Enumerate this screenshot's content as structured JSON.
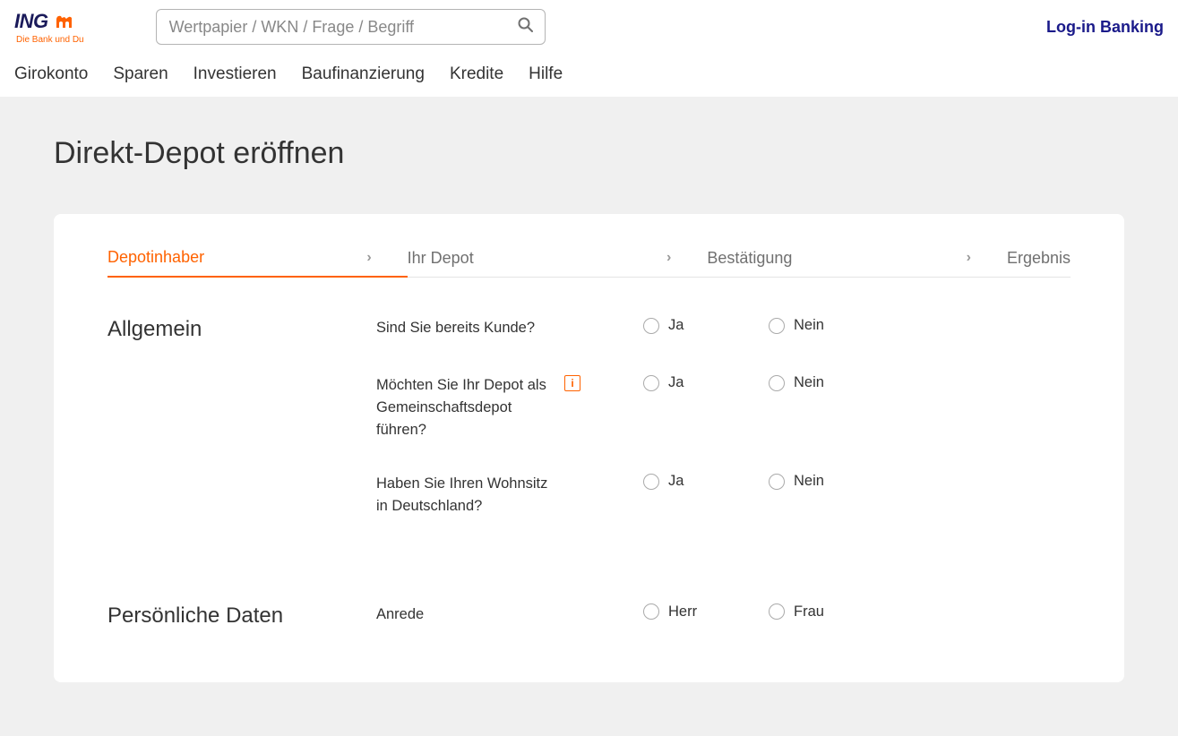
{
  "brand": {
    "name": "ING",
    "tagline": "Die Bank und Du"
  },
  "search": {
    "placeholder": "Wertpapier / WKN / Frage / Begriff"
  },
  "login": "Log-in Banking",
  "nav": [
    "Girokonto",
    "Sparen",
    "Investieren",
    "Baufinanzierung",
    "Kredite",
    "Hilfe"
  ],
  "page_title": "Direkt-Depot eröffnen",
  "steps": [
    {
      "label": "Depotinhaber",
      "active": true
    },
    {
      "label": "Ihr Depot",
      "active": false
    },
    {
      "label": "Bestätigung",
      "active": false
    },
    {
      "label": "Ergebnis",
      "active": false
    }
  ],
  "sections": {
    "general": {
      "title": "Allgemein",
      "q1": {
        "label": "Sind Sie bereits Kunde?",
        "yes": "Ja",
        "no": "Nein"
      },
      "q2": {
        "label": "Möchten Sie Ihr Depot als Gemeinschaftsdepot führen?",
        "yes": "Ja",
        "no": "Nein"
      },
      "q3": {
        "label": "Haben Sie Ihren Wohnsitz in Deutschland?",
        "yes": "Ja",
        "no": "Nein"
      }
    },
    "personal": {
      "title": "Persönliche Daten",
      "salutation": {
        "label": "Anrede",
        "m": "Herr",
        "f": "Frau"
      }
    }
  }
}
